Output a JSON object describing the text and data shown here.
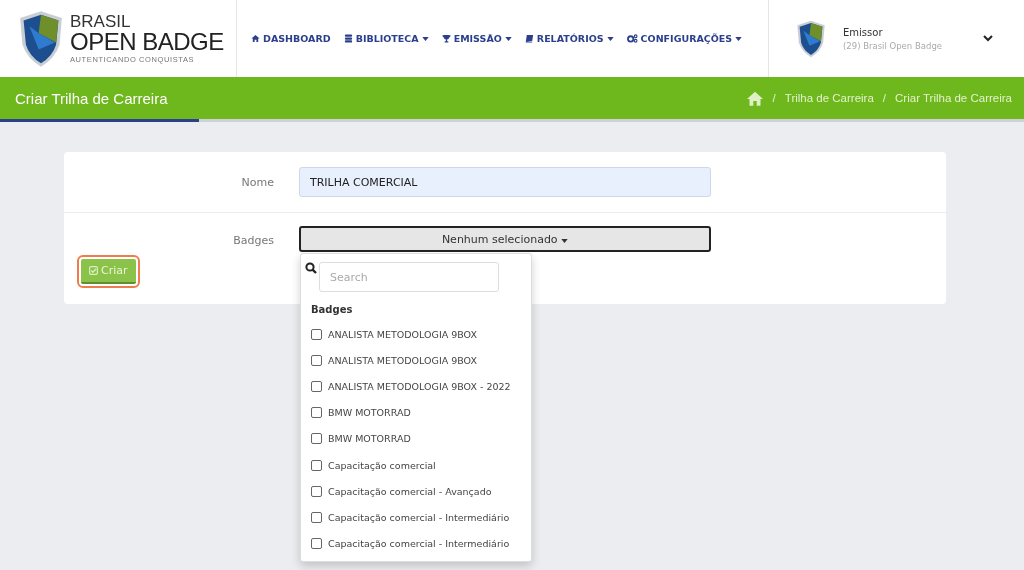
{
  "header": {
    "logo": {
      "line1": "BRASIL",
      "line2": "OPEN BADGE",
      "tagline": "AUTENTICANDO CONQUISTAS"
    },
    "nav": [
      {
        "label": "DASHBOARD",
        "dropdown": false
      },
      {
        "label": "BIBLIOTECA",
        "dropdown": true
      },
      {
        "label": "EMISSÃO",
        "dropdown": true
      },
      {
        "label": "RELATÓRIOS",
        "dropdown": true
      },
      {
        "label": "CONFIGURAÇÕES",
        "dropdown": true
      }
    ],
    "user": {
      "role": "Emissor",
      "org": "(29) Brasil Open Badge"
    }
  },
  "page_title": "Criar Trilha de Carreira",
  "breadcrumb_separator": "/",
  "breadcrumb": [
    "Trilha de Carreira",
    "Criar Trilha de Carreira"
  ],
  "form": {
    "name_label": "Nome",
    "name_value": "TRILHA COMERCIAL",
    "badges_label": "Badges",
    "badges_select": "Nenhum selecionado",
    "submit": "Criar"
  },
  "dropdown": {
    "search_placeholder": "Search",
    "group_label": "Badges",
    "items": [
      {
        "label": "ANALISTA METODOLOGIA 9BOX",
        "checked": false
      },
      {
        "label": "ANALISTA METODOLOGIA 9BOX",
        "checked": false
      },
      {
        "label": "ANALISTA METODOLOGIA 9BOX - 2022",
        "checked": false
      },
      {
        "label": "BMW MOTORRAD",
        "checked": false
      },
      {
        "label": "BMW MOTORRAD",
        "checked": false
      },
      {
        "label": "Capacitação comercial",
        "checked": false
      },
      {
        "label": "Capacitação comercial - Avançado",
        "checked": false
      },
      {
        "label": "Capacitação comercial - Intermediário",
        "checked": false
      },
      {
        "label": "Capacitação comercial - Intermediário",
        "checked": false
      }
    ]
  }
}
